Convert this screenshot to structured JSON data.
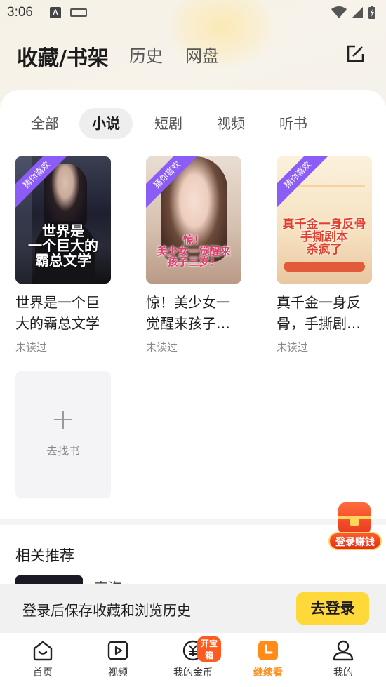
{
  "status_bar": {
    "time": "3:06",
    "input_badge": "A"
  },
  "header": {
    "tabs": [
      {
        "label": "收藏/书架",
        "active": true
      },
      {
        "label": "历史",
        "active": false
      },
      {
        "label": "网盘",
        "active": false
      }
    ],
    "edit_icon": "edit-icon"
  },
  "filter_tabs": [
    {
      "label": "全部",
      "active": false
    },
    {
      "label": "小说",
      "active": true
    },
    {
      "label": "短剧",
      "active": false
    },
    {
      "label": "视频",
      "active": false
    },
    {
      "label": "听书",
      "active": false
    }
  ],
  "books": [
    {
      "ribbon": "猜你喜欢",
      "cover_text": "世界是\n一个巨大的\n霸总文学",
      "title": "世界是一个巨大的霸总文学",
      "status": "未读过"
    },
    {
      "ribbon": "猜你喜欢",
      "cover_text": "惊！\n美少女一觉醒来\n孩子三岁！",
      "title": "惊！美少女一觉醒来孩子…",
      "status": "未读过"
    },
    {
      "ribbon": "猜你喜欢",
      "cover_text": "真千金一身反骨\n手撕剧本\n杀疯了",
      "title": "真千金一身反骨，手撕剧…",
      "status": "未读过"
    }
  ],
  "add_book": {
    "label": "去找书"
  },
  "related": {
    "title": "相关推荐",
    "item_text": "高海...",
    "thumb_text": ""
  },
  "float_reward": {
    "label": "登录赚钱"
  },
  "login_banner": {
    "text": "登录后保存收藏和浏览历史",
    "button": "去登录"
  },
  "bottom_nav": [
    {
      "label": "首页",
      "icon": "home-icon",
      "active": false
    },
    {
      "label": "视频",
      "icon": "video-icon",
      "active": false
    },
    {
      "label": "我的金币",
      "icon": "coin-icon",
      "active": false,
      "badge": "开宝箱"
    },
    {
      "label": "继续看",
      "icon": "continue-icon",
      "active": true
    },
    {
      "label": "我的",
      "icon": "profile-icon",
      "active": false
    }
  ],
  "colors": {
    "accent": "#ffd83a",
    "active_nav": "#ff8c1a",
    "ribbon": "#8b5cf6"
  }
}
